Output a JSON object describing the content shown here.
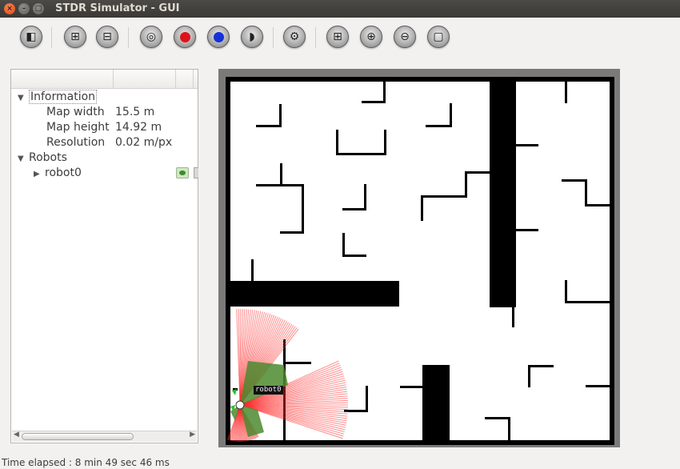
{
  "window": {
    "title": "STDR Simulator - GUI",
    "close_glyph": "×",
    "min_glyph": "–",
    "max_glyph": "□"
  },
  "toolbar": {
    "buttons": [
      {
        "name": "load-map-icon",
        "glyph": "◧"
      },
      {
        "name": "add-robot-icon",
        "glyph": "⊞"
      },
      {
        "name": "load-robot-icon",
        "glyph": "⊟"
      },
      {
        "name": "rfid-tag-icon",
        "glyph": "◎"
      },
      {
        "name": "co2-source-icon",
        "color": "#e0121a"
      },
      {
        "name": "thermal-source-icon",
        "color": "#1530d8"
      },
      {
        "name": "sound-source-icon",
        "glyph": "◗"
      },
      {
        "name": "settings-gear-icon",
        "glyph": "⚙"
      },
      {
        "name": "grid-icon",
        "glyph": "⊞"
      },
      {
        "name": "zoom-in-icon",
        "glyph": "⊕"
      },
      {
        "name": "zoom-out-icon",
        "glyph": "⊖"
      },
      {
        "name": "adjust-map-icon",
        "glyph": "▢"
      }
    ]
  },
  "tree": {
    "information": {
      "label": "Information",
      "expand_glyph": "▼",
      "rows": [
        {
          "key": "Map width",
          "value": "15.5 m"
        },
        {
          "key": "Map height",
          "value": "14.92 m"
        },
        {
          "key": "Resolution",
          "value": "0.02 m/px"
        }
      ]
    },
    "robots": {
      "label": "Robots",
      "expand_glyph": "▼",
      "items": [
        {
          "label": "robot0",
          "expand_glyph": "▶"
        }
      ]
    },
    "scroll_left_glyph": "◀",
    "scroll_right_glyph": "▶"
  },
  "map": {
    "robot_label": "robot0",
    "colors": {
      "wall": "#000000",
      "laser": "#ff2b2b",
      "sonar": "#4c8a2f",
      "robot": "#2fbf2f"
    }
  },
  "status": {
    "time_elapsed": "Time elapsed : 8 min 49 sec 46 ms"
  }
}
